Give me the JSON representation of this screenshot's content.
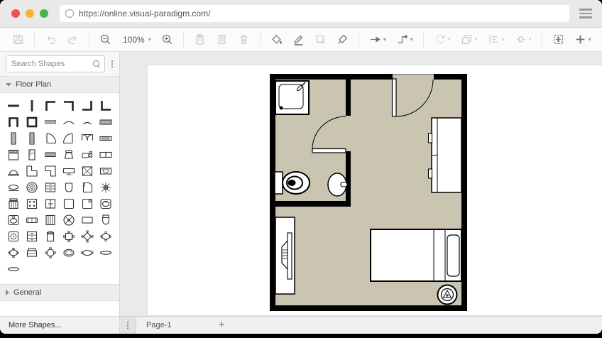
{
  "browser": {
    "url": "https://online.visual-paradigm.com/",
    "traffic_lights": {
      "close": "#ee544a",
      "minimize": "#f5b32e",
      "maximize": "#48b648"
    }
  },
  "toolbar": {
    "zoom_level": "100%",
    "items": [
      {
        "type": "icon",
        "name": "save",
        "icon": "save",
        "disabled": true
      },
      {
        "type": "divider"
      },
      {
        "type": "icon",
        "name": "undo",
        "icon": "undo",
        "disabled": true
      },
      {
        "type": "icon",
        "name": "redo",
        "icon": "redo",
        "disabled": true
      },
      {
        "type": "divider"
      },
      {
        "type": "icon",
        "name": "zoom-out",
        "icon": "zoomout",
        "disabled": false
      },
      {
        "type": "zoom",
        "name": "zoom-level",
        "caret": true
      },
      {
        "type": "icon",
        "name": "zoom-in",
        "icon": "zoomin",
        "disabled": false
      },
      {
        "type": "divider"
      },
      {
        "type": "icon",
        "name": "paste",
        "icon": "paste",
        "disabled": true
      },
      {
        "type": "icon",
        "name": "properties",
        "icon": "props",
        "disabled": true
      },
      {
        "type": "icon",
        "name": "delete",
        "icon": "trash",
        "disabled": true
      },
      {
        "type": "divider"
      },
      {
        "type": "icon",
        "name": "fill-color",
        "icon": "fill",
        "disabled": false
      },
      {
        "type": "icon",
        "name": "line-color",
        "icon": "pencil",
        "disabled": false
      },
      {
        "type": "icon",
        "name": "shadow",
        "icon": "shadow",
        "disabled": true
      },
      {
        "type": "icon",
        "name": "format-painter",
        "icon": "brush",
        "disabled": false
      },
      {
        "type": "divider"
      },
      {
        "type": "icon",
        "name": "connection-style",
        "icon": "arrow",
        "disabled": false,
        "caret": true
      },
      {
        "type": "icon",
        "name": "waypoint-style",
        "icon": "elbow",
        "disabled": false,
        "caret": true
      },
      {
        "type": "divider"
      },
      {
        "type": "icon",
        "name": "rotate",
        "icon": "rotate",
        "disabled": true,
        "caret": true
      },
      {
        "type": "icon",
        "name": "layer-order",
        "icon": "layers",
        "disabled": true,
        "caret": true
      },
      {
        "type": "icon",
        "name": "align",
        "icon": "align",
        "disabled": true,
        "caret": true
      },
      {
        "type": "icon",
        "name": "distribute",
        "icon": "dist",
        "disabled": true,
        "caret": true
      },
      {
        "type": "divider"
      },
      {
        "type": "icon",
        "name": "fit-page",
        "icon": "fit",
        "disabled": false
      },
      {
        "type": "icon",
        "name": "insert",
        "icon": "plus",
        "disabled": false,
        "caret": true
      },
      {
        "type": "spacer"
      },
      {
        "type": "icon",
        "name": "format-panel",
        "icon": "panel1",
        "disabled": false
      },
      {
        "type": "icon",
        "name": "outline-panel",
        "icon": "panel2",
        "disabled": false,
        "caret": true
      }
    ]
  },
  "sidebar": {
    "search_placeholder": "Search Shapes",
    "sections": [
      {
        "label": "Floor Plan",
        "expanded": true
      },
      {
        "label": "General",
        "expanded": false
      }
    ],
    "more_shapes_label": "More Shapes...",
    "shapes": [
      {
        "n": "wall-horizontal",
        "g": "wall-h"
      },
      {
        "n": "wall-vertical",
        "g": "wall-v"
      },
      {
        "n": "wall-corner-nw",
        "g": "c-nw"
      },
      {
        "n": "wall-corner-ne",
        "g": "c-ne"
      },
      {
        "n": "wall-corner-se",
        "g": "c-se"
      },
      {
        "n": "wall-corner-sw",
        "g": "c-sw"
      },
      {
        "n": "wall-u-shape",
        "g": "u"
      },
      {
        "n": "room-square",
        "g": "room"
      },
      {
        "n": "wall-section",
        "g": "wallseg"
      },
      {
        "n": "curved-wall-1",
        "g": "arc1"
      },
      {
        "n": "curved-wall-2",
        "g": "arc2"
      },
      {
        "n": "hatched-wall",
        "g": "hatch-h"
      },
      {
        "n": "hatched-wall-vertical",
        "g": "hatch-v"
      },
      {
        "n": "hatched-wall-vertical-2",
        "g": "hatch-v"
      },
      {
        "n": "door-right",
        "g": "door1"
      },
      {
        "n": "door-left",
        "g": "door2"
      },
      {
        "n": "double-door",
        "g": "door-dbl"
      },
      {
        "n": "window",
        "g": "window1"
      },
      {
        "n": "double-bed",
        "g": "bed"
      },
      {
        "n": "refrigerator",
        "g": "fridge"
      },
      {
        "n": "low-cabinet",
        "g": "cablow"
      },
      {
        "n": "hopper",
        "g": "hopper"
      },
      {
        "n": "camera",
        "g": "camera"
      },
      {
        "n": "double-window",
        "g": "window2"
      },
      {
        "n": "vanity",
        "g": "vanity"
      },
      {
        "n": "corner-counter-left",
        "g": "cl1"
      },
      {
        "n": "corner-counter-right",
        "g": "cl2"
      },
      {
        "n": "flat-tv",
        "g": "tvflat"
      },
      {
        "n": "stairs",
        "g": "stx"
      },
      {
        "n": "widescreen-tv",
        "g": "tv2"
      },
      {
        "n": "coffee-table",
        "g": "tablelow"
      },
      {
        "n": "stove-burner",
        "g": "burner"
      },
      {
        "n": "dresser",
        "g": "dresser"
      },
      {
        "n": "laundry-basket",
        "g": "bin"
      },
      {
        "n": "grand-piano",
        "g": "piano"
      },
      {
        "n": "plant",
        "g": "plant"
      },
      {
        "n": "office-chair",
        "g": "bench"
      },
      {
        "n": "card-table",
        "g": "t4"
      },
      {
        "n": "double-cabinet",
        "g": "cabd"
      },
      {
        "n": "plain-table",
        "g": "sqp"
      },
      {
        "n": "corner-table",
        "g": "sqc"
      },
      {
        "n": "toilet-top-view",
        "g": "sinkov"
      },
      {
        "n": "square-sink",
        "g": "sinkf"
      },
      {
        "n": "loveseat",
        "g": "sofa2"
      },
      {
        "n": "bookcase",
        "g": "cabv"
      },
      {
        "n": "ceiling-fan",
        "g": "fan"
      },
      {
        "n": "side-table",
        "g": "rectp"
      },
      {
        "n": "toilet-front-view",
        "g": "toiletf"
      },
      {
        "n": "speaker",
        "g": "speaker"
      },
      {
        "n": "drawer-unit",
        "g": "drawers"
      },
      {
        "n": "trash-can",
        "g": "cyl"
      },
      {
        "n": "square-table-chairs",
        "g": "tsq"
      },
      {
        "n": "diamond-table-chairs",
        "g": "tdia"
      },
      {
        "n": "oval-table-chairs",
        "g": "tov"
      },
      {
        "n": "conference-table",
        "g": "tov"
      },
      {
        "n": "printer",
        "g": "pianoup"
      },
      {
        "n": "round-table-chairs",
        "g": "trnd"
      },
      {
        "n": "oval-bathtub",
        "g": "tub"
      },
      {
        "n": "oval-table",
        "g": "ovh"
      },
      {
        "n": "small-rug",
        "g": "rug"
      },
      {
        "n": "rug",
        "g": "rug"
      }
    ]
  },
  "canvas": {
    "floorplan": {
      "floor_color": "#c9c5b1",
      "wall_color": "#000000",
      "rooms": [
        "bathroom",
        "bedroom"
      ],
      "furniture": [
        "shower",
        "bathroom-door",
        "toilet",
        "sink",
        "entry-door",
        "wardrobe",
        "bed",
        "tv-cabinet",
        "ceiling-lamp"
      ]
    }
  },
  "page_bar": {
    "tabs": [
      {
        "label": "Page-1",
        "active": true
      }
    ],
    "add_label": "+"
  }
}
